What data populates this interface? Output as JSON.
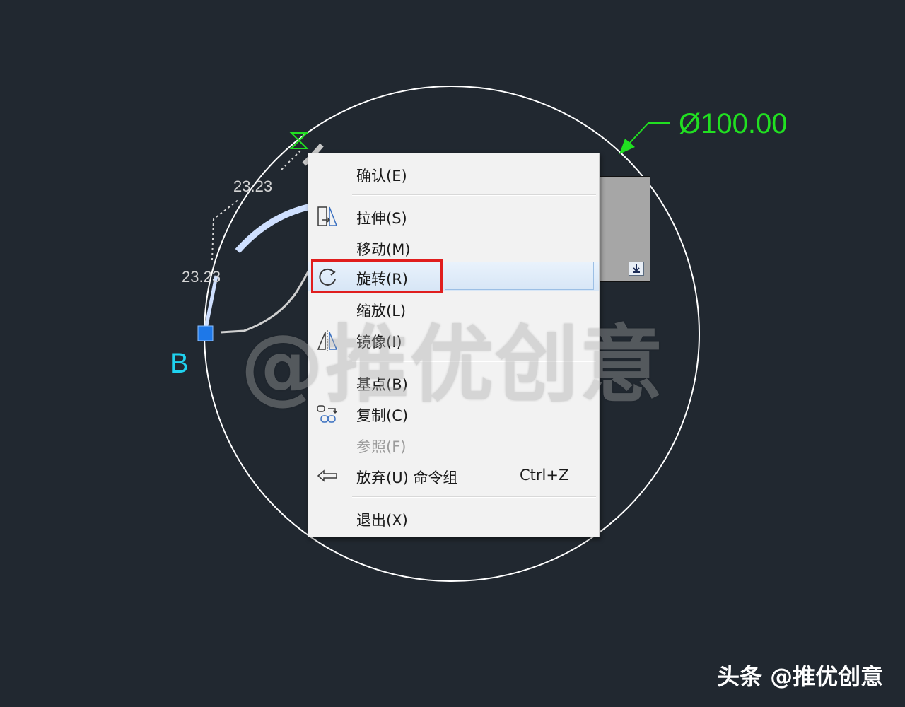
{
  "drawing": {
    "diameter_label": "Ø100.00",
    "dim_upper": "23.23",
    "dim_lower": "23.23",
    "point_label": "B",
    "colors": {
      "background": "#212830",
      "circle": "#ffffff",
      "dimension": "#21e021",
      "point_label": "#1fd3f0",
      "grip": "#1e78e8"
    }
  },
  "context_menu": {
    "items": [
      {
        "label": "确认(E)",
        "icon": ""
      },
      {
        "label": "拉伸(S)",
        "icon": "stretch-icon"
      },
      {
        "label": "移动(M)",
        "icon": ""
      },
      {
        "label": "旋转(R)",
        "icon": "rotate-icon",
        "highlighted": true
      },
      {
        "label": "缩放(L)",
        "icon": ""
      },
      {
        "label": "镜像(I)",
        "icon": "mirror-icon"
      },
      {
        "label": "基点(B)",
        "icon": ""
      },
      {
        "label": "复制(C)",
        "icon": "copy-icon"
      },
      {
        "label": "参照(F)",
        "icon": "",
        "disabled": true
      },
      {
        "label": "放弃(U) 命令组",
        "icon": "undo-icon",
        "shortcut": "Ctrl+Z"
      },
      {
        "label": "退出(X)",
        "icon": ""
      }
    ]
  },
  "annotation": {
    "color": "#e01e1e"
  },
  "watermark": "@推优创意",
  "footer": "头条 @推优创意"
}
